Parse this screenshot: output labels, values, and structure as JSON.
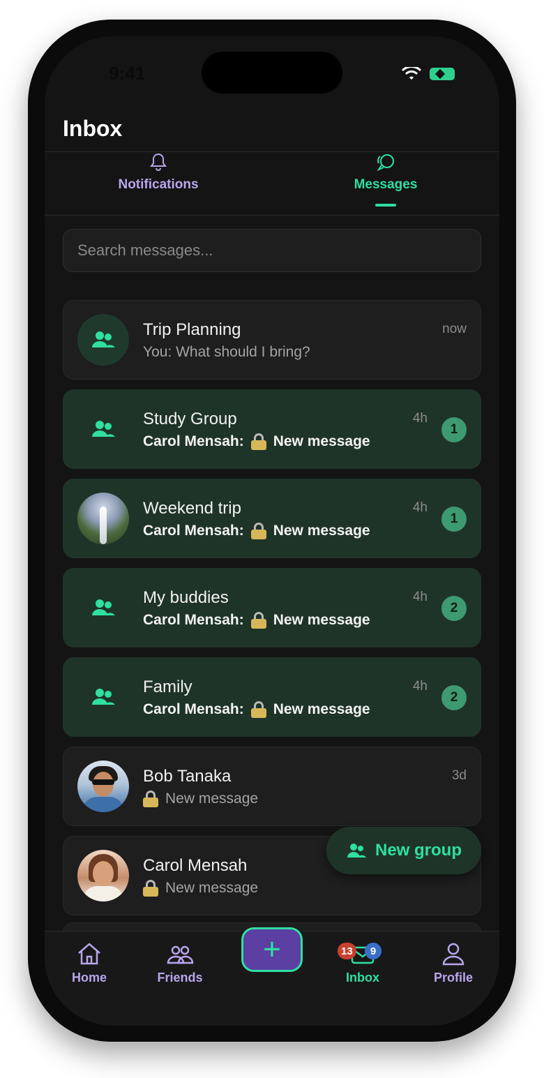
{
  "status_bar": {
    "time": "9:41"
  },
  "header": {
    "title": "Inbox"
  },
  "tabs": [
    {
      "label": "Notifications",
      "icon": "bell-icon",
      "active": false
    },
    {
      "label": "Messages",
      "icon": "chat-bubbles-icon",
      "active": true
    }
  ],
  "search": {
    "placeholder": "Search messages..."
  },
  "conversations": [
    {
      "name": "Trip Planning",
      "preview": "You: What should I bring?",
      "time": "now",
      "unread": 0,
      "avatar": "group-icon"
    },
    {
      "name": "Study Group",
      "sender": "Carol Mensah:",
      "preview": "New message",
      "time": "4h",
      "unread": "1",
      "avatar": "group-icon"
    },
    {
      "name": "Weekend trip",
      "sender": "Carol Mensah:",
      "preview": "New message",
      "time": "4h",
      "unread": "1",
      "avatar": "waterfall-photo"
    },
    {
      "name": "My buddies",
      "sender": "Carol Mensah:",
      "preview": "New message",
      "time": "4h",
      "unread": "2",
      "avatar": "group-icon"
    },
    {
      "name": "Family",
      "sender": "Carol Mensah:",
      "preview": "New message",
      "time": "4h",
      "unread": "2",
      "avatar": "group-icon"
    },
    {
      "name": "Bob Tanaka",
      "preview": "New message",
      "time": "3d",
      "unread": 0,
      "avatar": "user-photo"
    },
    {
      "name": "Carol Mensah",
      "preview": "New message",
      "time": "",
      "unread": 0,
      "avatar": "user-photo"
    }
  ],
  "fab": {
    "label": "New group",
    "icon": "group-icon"
  },
  "bottom_nav": {
    "home": "Home",
    "friends": "Friends",
    "create_icon": "plus-icon",
    "inbox": "Inbox",
    "inbox_badge_red": "13",
    "inbox_badge_blue": "9",
    "profile": "Profile"
  },
  "colors": {
    "accent": "#2fe0a0",
    "secondary": "#b9a6ee",
    "unread_bg": "#1f3429",
    "background": "#141414"
  }
}
